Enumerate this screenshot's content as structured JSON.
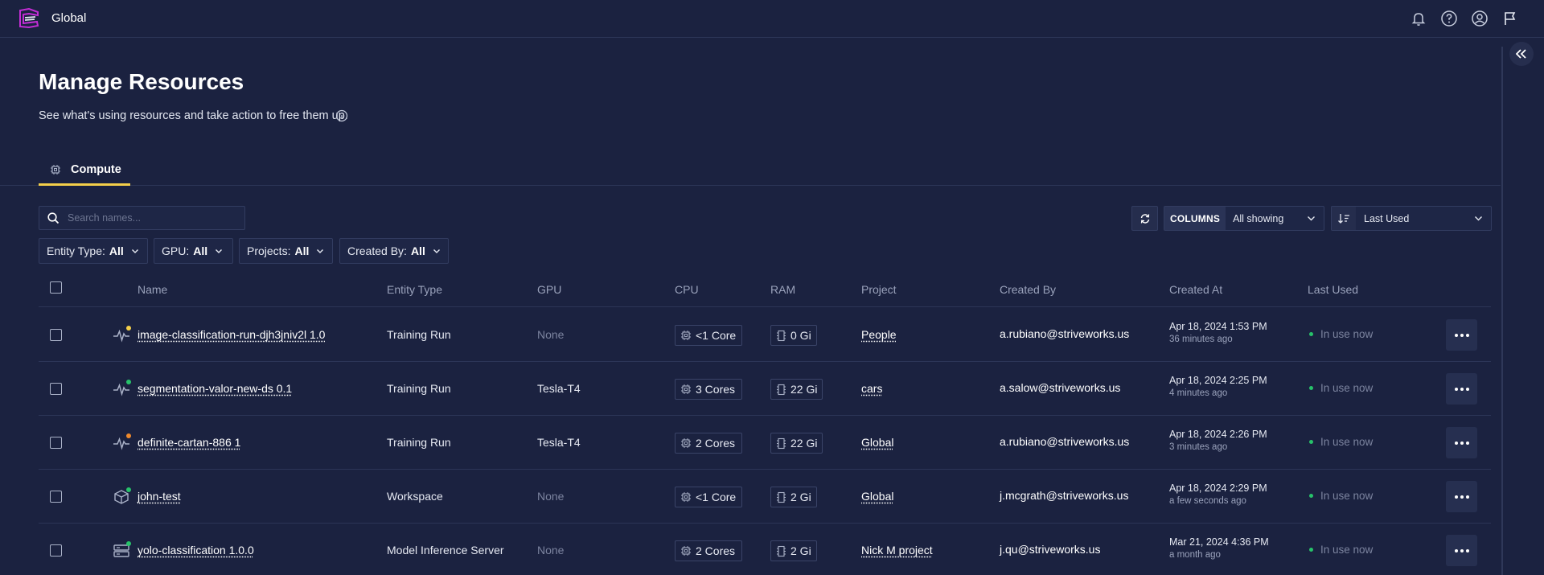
{
  "header": {
    "scope": "Global"
  },
  "page": {
    "title": "Manage Resources",
    "subtitle": "See what's using resources and take action to free them up."
  },
  "tabs": [
    {
      "label": "Compute",
      "active": true
    }
  ],
  "search": {
    "placeholder": "Search names..."
  },
  "filters": [
    {
      "label": "Entity Type:",
      "value": "All"
    },
    {
      "label": "GPU:",
      "value": "All"
    },
    {
      "label": "Projects:",
      "value": "All"
    },
    {
      "label": "Created By:",
      "value": "All"
    }
  ],
  "toolbar": {
    "columns_label": "COLUMNS",
    "columns_value": "All showing",
    "sort_value": "Last Used"
  },
  "table": {
    "headers": {
      "name": "Name",
      "entity_type": "Entity Type",
      "gpu": "GPU",
      "cpu": "CPU",
      "ram": "RAM",
      "project": "Project",
      "created_by": "Created By",
      "created_at": "Created At",
      "last_used": "Last Used"
    },
    "rows": [
      {
        "name": "image-classification-run-djh3jniv2l 1.0",
        "entity_type": "Training Run",
        "icon": "activity-icon",
        "status_color": "#f4cf4a",
        "gpu": "None",
        "cpu": "<1 Core",
        "ram": "0 Gi",
        "project": "People",
        "created_by": "a.rubiano@striveworks.us",
        "created_at": "Apr 18, 2024 1:53 PM",
        "created_ago": "36 minutes ago",
        "last_used": "In use now"
      },
      {
        "name": "segmentation-valor-new-ds 0.1",
        "entity_type": "Training Run",
        "icon": "activity-icon",
        "status_color": "#27c26a",
        "gpu": "Tesla-T4",
        "cpu": "3 Cores",
        "ram": "22 Gi",
        "project": "cars",
        "created_by": "a.salow@striveworks.us",
        "created_at": "Apr 18, 2024 2:25 PM",
        "created_ago": "4 minutes ago",
        "last_used": "In use now"
      },
      {
        "name": "definite-cartan-886 1",
        "entity_type": "Training Run",
        "icon": "activity-icon",
        "status_color": "#f08a2c",
        "gpu": "Tesla-T4",
        "cpu": "2 Cores",
        "ram": "22 Gi",
        "project": "Global",
        "created_by": "a.rubiano@striveworks.us",
        "created_at": "Apr 18, 2024 2:26 PM",
        "created_ago": "3 minutes ago",
        "last_used": "In use now"
      },
      {
        "name": "john-test",
        "entity_type": "Workspace",
        "icon": "cube-icon",
        "status_color": "#27c26a",
        "gpu": "None",
        "cpu": "<1 Core",
        "ram": "2 Gi",
        "project": "Global",
        "created_by": "j.mcgrath@striveworks.us",
        "created_at": "Apr 18, 2024 2:29 PM",
        "created_ago": "a few seconds ago",
        "last_used": "In use now"
      },
      {
        "name": "yolo-classification 1.0.0",
        "entity_type": "Model Inference Server",
        "icon": "server-icon",
        "status_color": "#27c26a",
        "gpu": "None",
        "cpu": "2 Cores",
        "ram": "2 Gi",
        "project": "Nick M project",
        "created_by": "j.qu@striveworks.us",
        "created_at": "Mar 21, 2024 4:36 PM",
        "created_ago": "a month ago",
        "last_used": "In use now"
      }
    ]
  },
  "colors": {
    "background": "#1b2240",
    "accent": "#f4cf4a",
    "brand": "#c22dd4",
    "status_active": "#27c26a"
  }
}
